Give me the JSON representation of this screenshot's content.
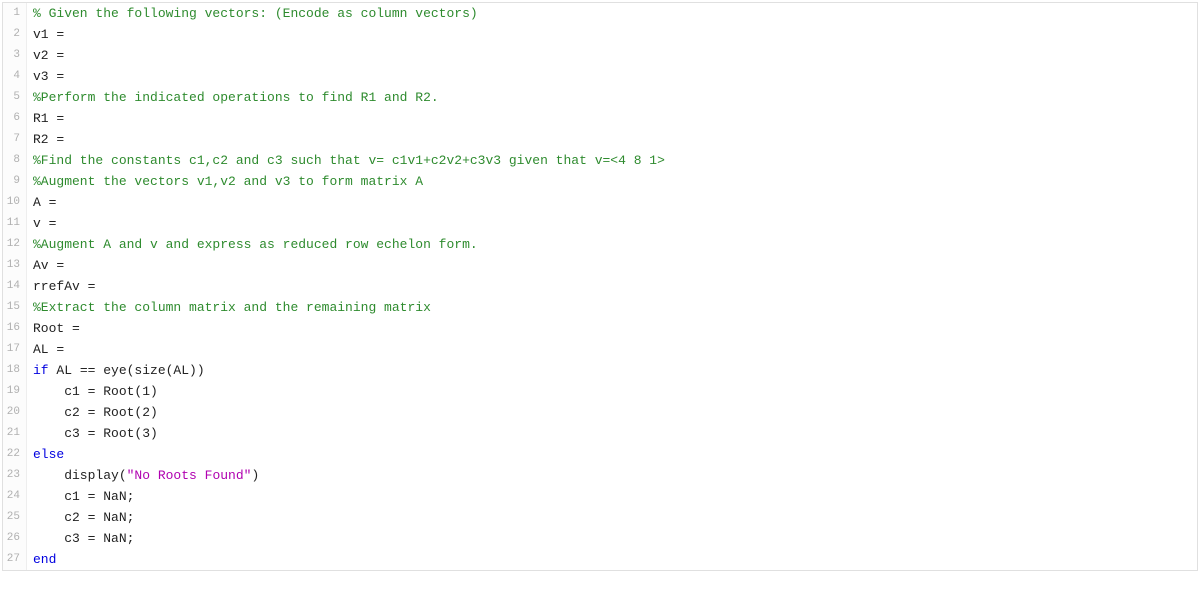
{
  "lines": [
    {
      "n": 1,
      "tokens": [
        {
          "cls": "tok-comment",
          "t": "% Given the following vectors: (Encode as column vectors)"
        }
      ]
    },
    {
      "n": 2,
      "tokens": [
        {
          "cls": "tok-plain",
          "t": "v1 = "
        }
      ]
    },
    {
      "n": 3,
      "tokens": [
        {
          "cls": "tok-plain",
          "t": "v2 = "
        }
      ]
    },
    {
      "n": 4,
      "tokens": [
        {
          "cls": "tok-plain",
          "t": "v3 = "
        }
      ]
    },
    {
      "n": 5,
      "tokens": [
        {
          "cls": "tok-comment",
          "t": "%Perform the indicated operations to find R1 and R2."
        }
      ]
    },
    {
      "n": 6,
      "tokens": [
        {
          "cls": "tok-plain",
          "t": "R1 = "
        }
      ]
    },
    {
      "n": 7,
      "tokens": [
        {
          "cls": "tok-plain",
          "t": "R2 = "
        }
      ]
    },
    {
      "n": 8,
      "tokens": [
        {
          "cls": "tok-comment",
          "t": "%Find the constants c1,c2 and c3 such that v= c1v1+c2v2+c3v3 given that v=<4 8 1>"
        }
      ]
    },
    {
      "n": 9,
      "tokens": [
        {
          "cls": "tok-comment",
          "t": "%Augment the vectors v1,v2 and v3 to form matrix A"
        }
      ]
    },
    {
      "n": 10,
      "tokens": [
        {
          "cls": "tok-plain",
          "t": "A = "
        }
      ]
    },
    {
      "n": 11,
      "tokens": [
        {
          "cls": "tok-plain",
          "t": "v = "
        }
      ]
    },
    {
      "n": 12,
      "tokens": [
        {
          "cls": "tok-comment",
          "t": "%Augment A and v and express as reduced row echelon form."
        }
      ]
    },
    {
      "n": 13,
      "tokens": [
        {
          "cls": "tok-plain",
          "t": "Av = "
        }
      ]
    },
    {
      "n": 14,
      "tokens": [
        {
          "cls": "tok-plain",
          "t": "rrefAv = "
        }
      ]
    },
    {
      "n": 15,
      "tokens": [
        {
          "cls": "tok-comment",
          "t": "%Extract the column matrix and the remaining matrix"
        }
      ]
    },
    {
      "n": 16,
      "tokens": [
        {
          "cls": "tok-plain",
          "t": "Root = "
        }
      ]
    },
    {
      "n": 17,
      "tokens": [
        {
          "cls": "tok-plain",
          "t": "AL = "
        }
      ]
    },
    {
      "n": 18,
      "tokens": [
        {
          "cls": "tok-keyword",
          "t": "if"
        },
        {
          "cls": "tok-plain",
          "t": " AL == eye(size(AL))"
        }
      ]
    },
    {
      "n": 19,
      "tokens": [
        {
          "cls": "tok-plain",
          "t": "    c1 = Root(1)"
        }
      ]
    },
    {
      "n": 20,
      "tokens": [
        {
          "cls": "tok-plain",
          "t": "    c2 = Root(2)"
        }
      ]
    },
    {
      "n": 21,
      "tokens": [
        {
          "cls": "tok-plain",
          "t": "    c3 = Root(3)"
        }
      ]
    },
    {
      "n": 22,
      "tokens": [
        {
          "cls": "tok-keyword",
          "t": "else"
        }
      ]
    },
    {
      "n": 23,
      "tokens": [
        {
          "cls": "tok-plain",
          "t": "    display("
        },
        {
          "cls": "tok-string",
          "t": "\"No Roots Found\""
        },
        {
          "cls": "tok-plain",
          "t": ")"
        }
      ]
    },
    {
      "n": 24,
      "tokens": [
        {
          "cls": "tok-plain",
          "t": "    c1 = NaN;"
        }
      ]
    },
    {
      "n": 25,
      "tokens": [
        {
          "cls": "tok-plain",
          "t": "    c2 = NaN;"
        }
      ]
    },
    {
      "n": 26,
      "tokens": [
        {
          "cls": "tok-plain",
          "t": "    c3 = NaN;"
        }
      ]
    },
    {
      "n": 27,
      "tokens": [
        {
          "cls": "tok-keyword",
          "t": "end"
        }
      ]
    }
  ]
}
